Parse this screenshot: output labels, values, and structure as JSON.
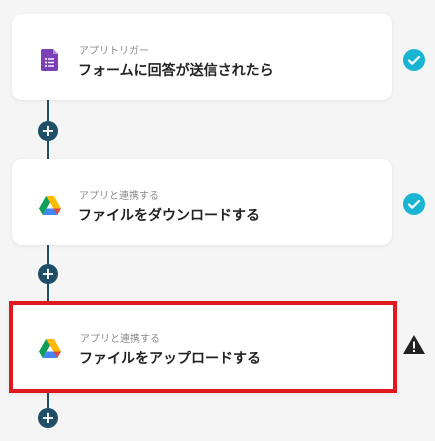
{
  "flow": {
    "steps": [
      {
        "subtitle": "アプリトリガー",
        "title": "フォームに回答が送信されたら",
        "icon": "google-forms-icon",
        "status": "check-circle-icon"
      },
      {
        "subtitle": "アプリと連携する",
        "title": "ファイルをダウンロードする",
        "icon": "google-drive-icon",
        "status": "check-circle-icon"
      },
      {
        "subtitle": "アプリと連携する",
        "title": "ファイルをアップロードする",
        "icon": "google-drive-icon",
        "status": "warning-icon",
        "highlighted": true
      }
    ],
    "add_label": "+"
  },
  "colors": {
    "accent": "#1f4e66",
    "check": "#19b4d2",
    "highlight_border": "#e0191e",
    "forms_purple": "#7b3fb6",
    "warning": "#222222"
  }
}
